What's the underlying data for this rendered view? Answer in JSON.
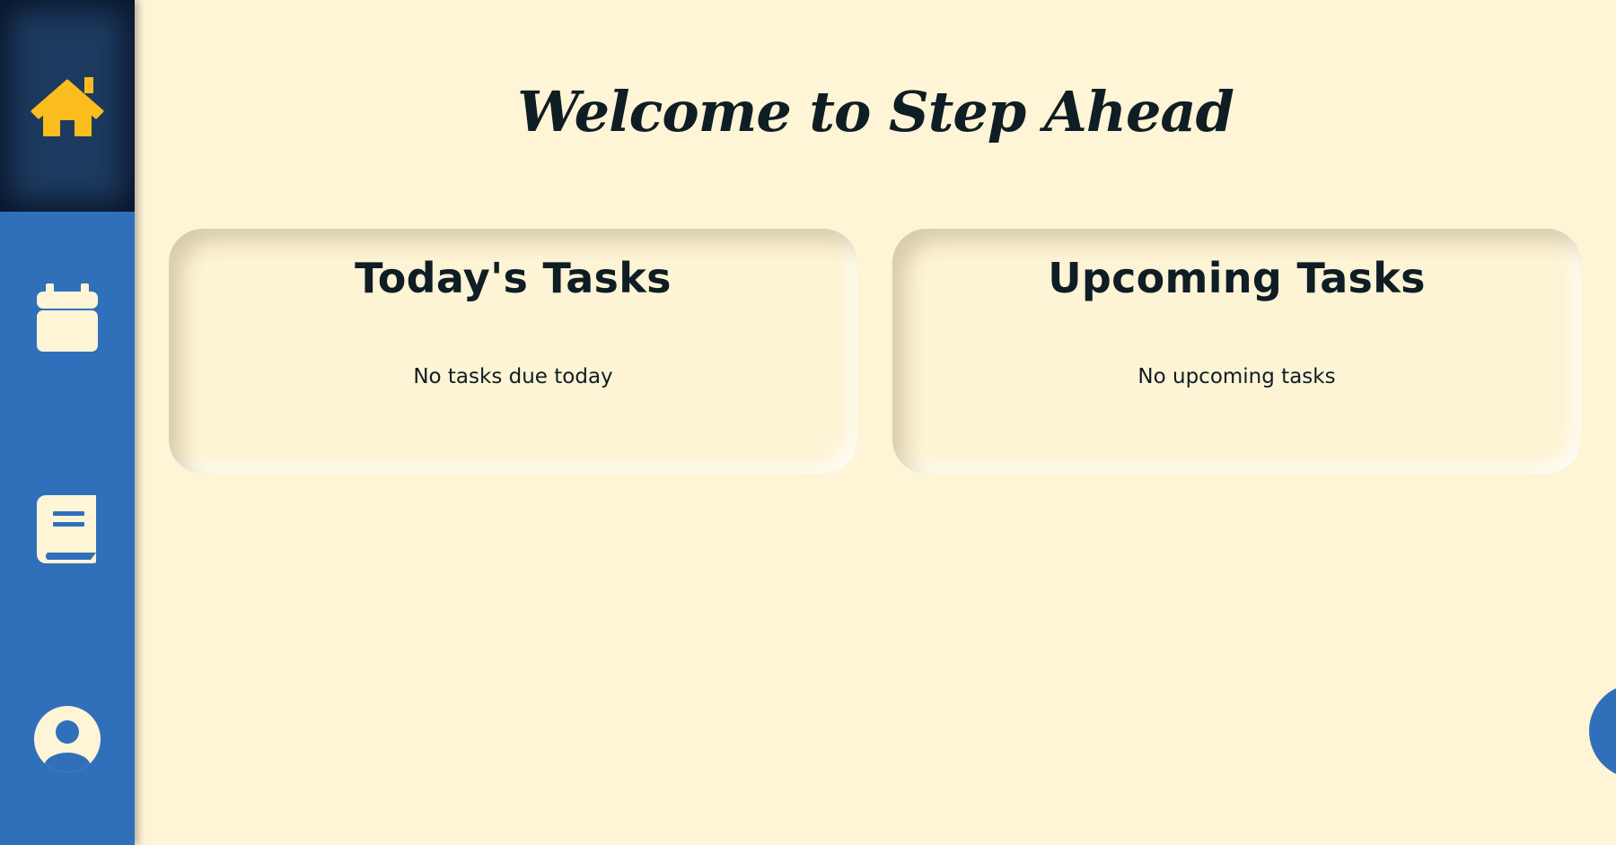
{
  "app": {
    "title": "Welcome to Step Ahead"
  },
  "sidebar": {
    "items": [
      {
        "name": "home",
        "icon": "home-icon",
        "active": true
      },
      {
        "name": "calendar",
        "icon": "calendar-icon",
        "active": false
      },
      {
        "name": "notes",
        "icon": "book-icon",
        "active": false
      },
      {
        "name": "profile",
        "icon": "user-circle-icon",
        "active": false
      }
    ]
  },
  "cards": {
    "today": {
      "title": "Today's Tasks",
      "empty_text": "No tasks due today"
    },
    "upcoming": {
      "title": "Upcoming Tasks",
      "empty_text": "No upcoming tasks"
    }
  },
  "fab": {
    "icon": "plus-icon"
  },
  "colors": {
    "background": "#fef4d6",
    "sidebar": "#3070bb",
    "sidebar_active": "#1d3b60",
    "accent": "#fbbd1e",
    "icon_light": "#fef4d6",
    "text": "#0f1d24"
  }
}
